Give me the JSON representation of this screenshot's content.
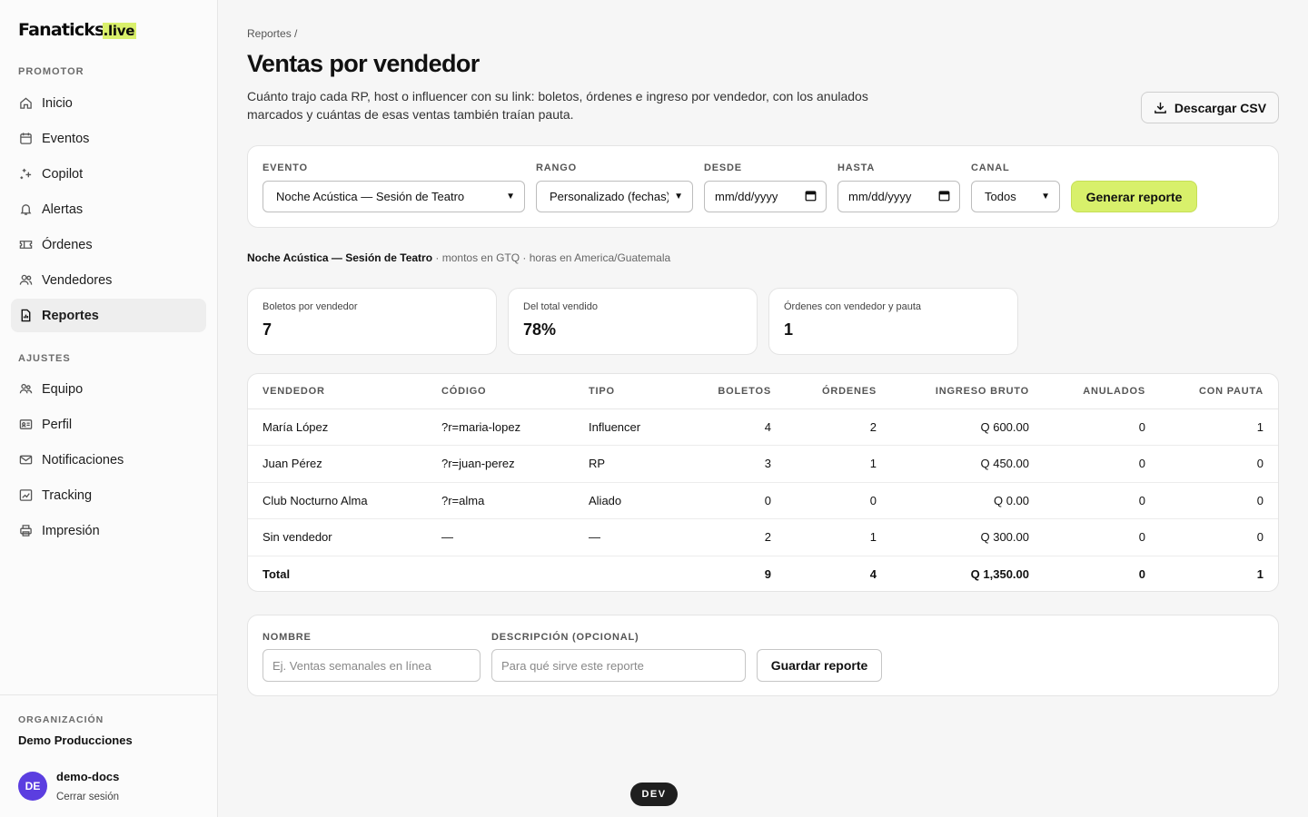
{
  "brand": {
    "name": "Fanaticks",
    "suffix": ".live"
  },
  "sidebar": {
    "promotor_label": "PROMOTOR",
    "promotor_items": [
      {
        "label": "Inicio",
        "icon": "home-icon"
      },
      {
        "label": "Eventos",
        "icon": "calendar-icon"
      },
      {
        "label": "Copilot",
        "icon": "sparkle-icon"
      },
      {
        "label": "Alertas",
        "icon": "bell-icon"
      },
      {
        "label": "Órdenes",
        "icon": "ticket-icon"
      },
      {
        "label": "Vendedores",
        "icon": "users-icon"
      },
      {
        "label": "Reportes",
        "icon": "report-icon",
        "active": true
      }
    ],
    "ajustes_label": "AJUSTES",
    "ajustes_items": [
      {
        "label": "Equipo",
        "icon": "team-icon"
      },
      {
        "label": "Perfil",
        "icon": "id-card-icon"
      },
      {
        "label": "Notificaciones",
        "icon": "mail-icon"
      },
      {
        "label": "Tracking",
        "icon": "chart-icon"
      },
      {
        "label": "Impresión",
        "icon": "printer-icon"
      }
    ],
    "org_label": "ORGANIZACIÓN",
    "org_name": "Demo Producciones",
    "user": {
      "initials": "DE",
      "name": "demo-docs",
      "logout": "Cerrar sesión"
    }
  },
  "header": {
    "breadcrumb": "Reportes /",
    "title": "Ventas por vendedor",
    "description": "Cuánto trajo cada RP, host o influencer con su link: boletos, órdenes e ingreso por vendedor, con los anulados marcados y cuántas de esas ventas también traían pauta.",
    "csv_button": "Descargar CSV"
  },
  "filters": {
    "evento_label": "EVENTO",
    "evento_value": "Noche Acústica — Sesión de Teatro",
    "rango_label": "RANGO",
    "rango_value": "Personalizado (fechas)",
    "desde_label": "DESDE",
    "desde_placeholder": "mm/dd/yyyy",
    "hasta_label": "HASTA",
    "hasta_placeholder": "mm/dd/yyyy",
    "canal_label": "CANAL",
    "canal_value": "Todos",
    "generate_button": "Generar reporte"
  },
  "context": {
    "event": "Noche Acústica — Sesión de Teatro",
    "meta": " · montos en GTQ · horas en America/Guatemala"
  },
  "metrics": [
    {
      "label": "Boletos por vendedor",
      "value": "7"
    },
    {
      "label": "Del total vendido",
      "value": "78%"
    },
    {
      "label": "Órdenes con vendedor y pauta",
      "value": "1"
    }
  ],
  "table": {
    "headers": [
      "VENDEDOR",
      "CÓDIGO",
      "TIPO",
      "BOLETOS",
      "ÓRDENES",
      "INGRESO BRUTO",
      "ANULADOS",
      "CON PAUTA"
    ],
    "rows": [
      [
        "María López",
        "?r=maria-lopez",
        "Influencer",
        "4",
        "2",
        "Q 600.00",
        "0",
        "1"
      ],
      [
        "Juan Pérez",
        "?r=juan-perez",
        "RP",
        "3",
        "1",
        "Q 450.00",
        "0",
        "0"
      ],
      [
        "Club Nocturno Alma",
        "?r=alma",
        "Aliado",
        "0",
        "0",
        "Q 0.00",
        "0",
        "0"
      ],
      [
        "Sin vendedor",
        "—",
        "—",
        "2",
        "1",
        "Q 300.00",
        "0",
        "0"
      ],
      [
        "Total",
        "",
        "",
        "9",
        "4",
        "Q 1,350.00",
        "0",
        "1"
      ]
    ]
  },
  "save": {
    "name_label": "NOMBRE",
    "name_placeholder": "Ej. Ventas semanales en línea",
    "desc_label": "DESCRIPCIÓN (OPCIONAL)",
    "desc_placeholder": "Para qué sirve este reporte",
    "button": "Guardar reporte"
  },
  "dev_badge": "DEV",
  "colors": {
    "accent": "#d8f06b",
    "avatar": "#5b3ee0"
  }
}
